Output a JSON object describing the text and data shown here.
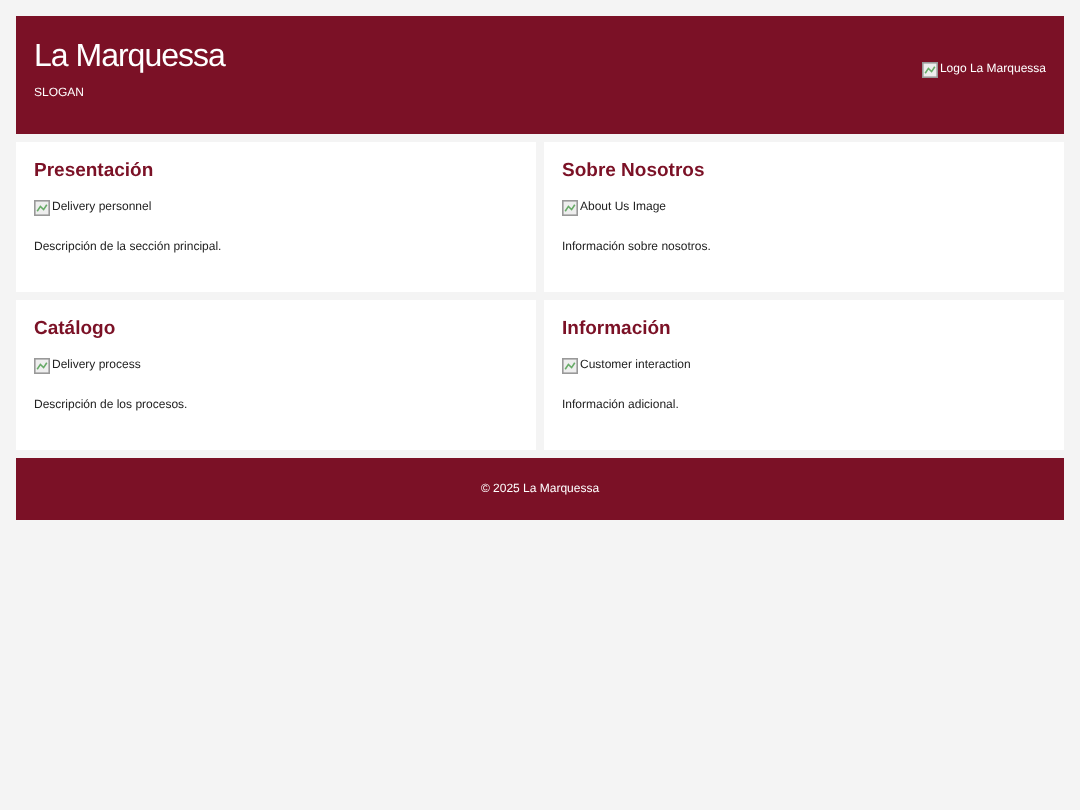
{
  "header": {
    "title": "La Marquessa",
    "slogan": "SLOGAN",
    "logo_alt": "Logo La Marquessa"
  },
  "sections": [
    {
      "title": "Presentación",
      "image_alt": "Delivery personnel",
      "text": "Descripción de la sección principal."
    },
    {
      "title": "Sobre Nosotros",
      "image_alt": "About Us Image",
      "text": "Información sobre nosotros."
    },
    {
      "title": "Catálogo",
      "image_alt": "Delivery process",
      "text": "Descripción de los procesos."
    },
    {
      "title": "Información",
      "image_alt": "Customer interaction",
      "text": "Información adicional."
    }
  ],
  "footer": {
    "text": "© 2025 La Marquessa"
  }
}
